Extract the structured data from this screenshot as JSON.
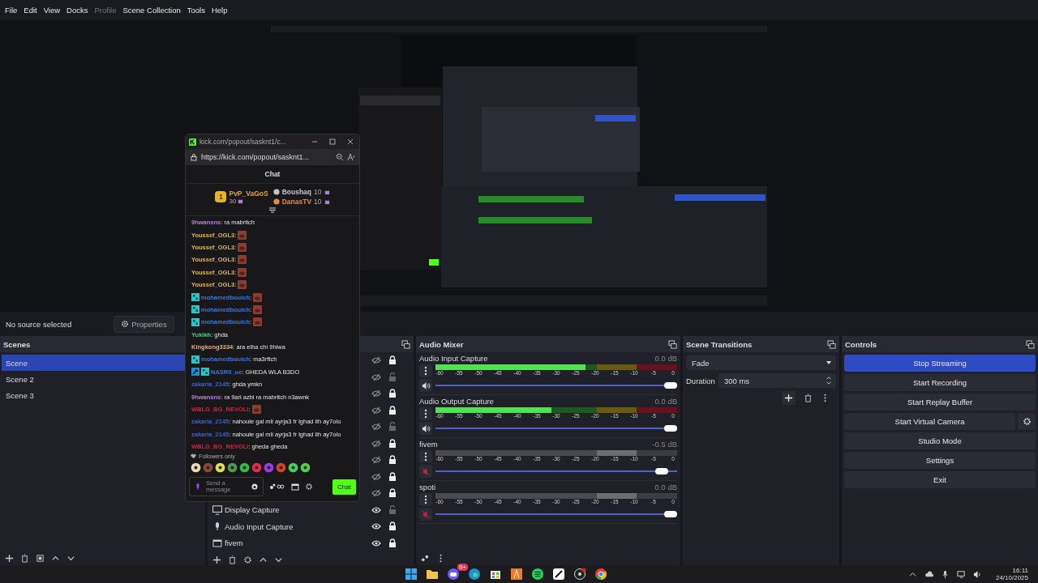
{
  "menu": [
    {
      "label": "File",
      "disabled": false
    },
    {
      "label": "Edit",
      "disabled": false
    },
    {
      "label": "View",
      "disabled": false
    },
    {
      "label": "Docks",
      "disabled": false
    },
    {
      "label": "Profile",
      "disabled": true
    },
    {
      "label": "Scene Collection",
      "disabled": false
    },
    {
      "label": "Tools",
      "disabled": false
    },
    {
      "label": "Help",
      "disabled": false
    }
  ],
  "source_toolbar": {
    "status": "No source selected",
    "properties_button": "Properties"
  },
  "scenes": {
    "title": "Scenes",
    "items": [
      {
        "name": "Scene",
        "selected": true
      },
      {
        "name": "Scene 2",
        "selected": false
      },
      {
        "name": "Scene 3",
        "selected": false
      }
    ]
  },
  "sources": {
    "items": [
      {
        "visible": false,
        "locked": true
      },
      {
        "visible": false,
        "locked": false
      },
      {
        "visible": false,
        "locked": true
      },
      {
        "visible": false,
        "locked": true
      },
      {
        "visible": false,
        "locked": false
      },
      {
        "visible": false,
        "locked": true
      },
      {
        "visible": false,
        "locked": true
      },
      {
        "visible": false,
        "locked": true
      },
      {
        "visible": false,
        "locked": true
      },
      {
        "name": "Display Capture",
        "kind": "display",
        "visible": true,
        "locked": false
      },
      {
        "name": "Audio Input Capture",
        "kind": "mic",
        "visible": true,
        "locked": true
      },
      {
        "name": "fivem",
        "kind": "window",
        "visible": true,
        "locked": true
      }
    ]
  },
  "mixer": {
    "title": "Audio Mixer",
    "channels": [
      {
        "name": "Audio Input Capture",
        "reading": "0.0 dB",
        "muted": false,
        "meter": {
          "level": 0.62
        },
        "volume": {
          "level": 1.0
        },
        "scale": [
          "-60",
          "-55",
          "-50",
          "-45",
          "-40",
          "-35",
          "-30",
          "-25",
          "-20",
          "-15",
          "-10",
          "-5",
          "0"
        ]
      },
      {
        "name": "Audio Output Capture",
        "reading": "0.0 dB",
        "muted": false,
        "meter": {
          "level": 0.48
        },
        "volume": {
          "level": 1.0
        },
        "scale": [
          "-60",
          "-55",
          "-50",
          "-45",
          "-40",
          "-35",
          "-30",
          "-25",
          "-20",
          "-15",
          "-10",
          "-5",
          "0"
        ]
      },
      {
        "name": "fivem",
        "reading": "-0.5 dB",
        "muted": true,
        "volume": {
          "level": 0.96
        },
        "scale": [
          "-60",
          "-55",
          "-50",
          "-45",
          "-40",
          "-35",
          "-30",
          "-25",
          "-20",
          "-15",
          "-10",
          "-5",
          "0"
        ]
      },
      {
        "name": "spoti",
        "reading": "0.0 dB",
        "muted": true,
        "volume": {
          "level": 1.0
        },
        "scale": [
          "-60",
          "-55",
          "-50",
          "-45",
          "-40",
          "-35",
          "-30",
          "-25",
          "-20",
          "-15",
          "-10",
          "-5",
          "0"
        ]
      }
    ]
  },
  "transitions": {
    "title": "Scene Transitions",
    "transition": "Fade",
    "duration_label": "Duration",
    "duration": "300 ms"
  },
  "controls": {
    "title": "Controls",
    "buttons": [
      {
        "label": "Stop Streaming",
        "active": true,
        "kind": "plain"
      },
      {
        "label": "Start Recording",
        "active": false,
        "kind": "plain"
      },
      {
        "label": "Start Replay Buffer",
        "active": false,
        "kind": "plain"
      },
      {
        "label": "Start Virtual Camera",
        "active": false,
        "kind": "with-settings"
      },
      {
        "label": "Studio Mode",
        "active": false,
        "kind": "plain"
      },
      {
        "label": "Settings",
        "active": false,
        "kind": "plain"
      },
      {
        "label": "Exit",
        "active": false,
        "kind": "plain"
      }
    ]
  },
  "chat_window": {
    "tab_title": "kick.com/popout/sasknt1/c...",
    "url": "https://kick.com/popout/sasknt1...",
    "heading": "Chat",
    "leaders": [
      {
        "kind": "first",
        "rank": "1",
        "name": "PvP_VaGoS",
        "points": "30",
        "color": "#e0a23a"
      },
      {
        "kind": "other",
        "name": "Boushaq",
        "points": "10",
        "color": "#c4c7cf"
      },
      {
        "kind": "other",
        "name": "DanasTV",
        "points": "10",
        "color": "#e98b3c"
      }
    ],
    "messages": [
      {
        "user": "9hwansns",
        "color": "#b77fe0",
        "kind": "text",
        "text": ": ra mabritch"
      },
      {
        "user": "Youssef_OGL3",
        "color": "#e3b64a",
        "kind": "emote",
        "text": ":"
      },
      {
        "user": "Youssef_OGL3",
        "color": "#e3b64a",
        "kind": "emote",
        "text": ":"
      },
      {
        "user": "Youssef_OGL3",
        "color": "#e3b64a",
        "kind": "emote",
        "text": ":"
      },
      {
        "user": "Youssef_OGL3",
        "color": "#e3b64a",
        "kind": "emote",
        "text": ":"
      },
      {
        "user": "Youssef_OGL3",
        "color": "#e3b64a",
        "kind": "emote",
        "text": ":"
      },
      {
        "user": "mohamedbouich",
        "color": "#3a78d8",
        "kind": "badge-emote",
        "text": ":"
      },
      {
        "user": "mohamedbouich",
        "color": "#3a78d8",
        "kind": "badge-emote",
        "text": ":"
      },
      {
        "user": "mohamedbouich",
        "color": "#3a78d8",
        "kind": "badge-emote",
        "text": ":"
      },
      {
        "user": "Yukikh",
        "color": "#52c98a",
        "kind": "text",
        "text": ": ghda"
      },
      {
        "user": "Kingkong3334",
        "color": "#e7ae7a",
        "kind": "text",
        "text": ": ara elha chi 9hiwa"
      },
      {
        "user": "mohamedbouich",
        "color": "#3a78d8",
        "kind": "badge-text",
        "text": ": ma3rftch"
      },
      {
        "user": "NASR0_ue",
        "color": "#3a78d8",
        "kind": "two-badge-text",
        "text": ": GHEDA WLA B3DO"
      },
      {
        "user": "zakaria_2145",
        "color": "#3e62c8",
        "kind": "text",
        "text": ": ghda ymkn"
      },
      {
        "user": "9hwansns",
        "color": "#b77fe0",
        "kind": "text",
        "text": ": ra 9ari azbi ra mabritch n3awnk"
      },
      {
        "user": "WBLG_BG_REVOLI",
        "color": "#d1213f",
        "kind": "emote",
        "text": ":"
      },
      {
        "user": "zakaria_2145",
        "color": "#3e62c8",
        "kind": "text",
        "text": ": nahoule gal mli ayrja3 fr lghad lih ay7olo"
      },
      {
        "user": "zakaria_2145",
        "color": "#3e62c8",
        "kind": "text",
        "text": ": nahoule gal mli ayrja3 fr lghad lih ay7olo"
      },
      {
        "user": "WBLG_BG_REVOLI",
        "color": "#d1213f",
        "kind": "text",
        "text": ": gheda gheda"
      }
    ],
    "mode": "Followers only",
    "input_placeholder": "Send a message",
    "send_button": "Chat"
  },
  "taskbar": {
    "discord_badge": "9+",
    "time": "16:11",
    "date": "24/10/2025"
  }
}
